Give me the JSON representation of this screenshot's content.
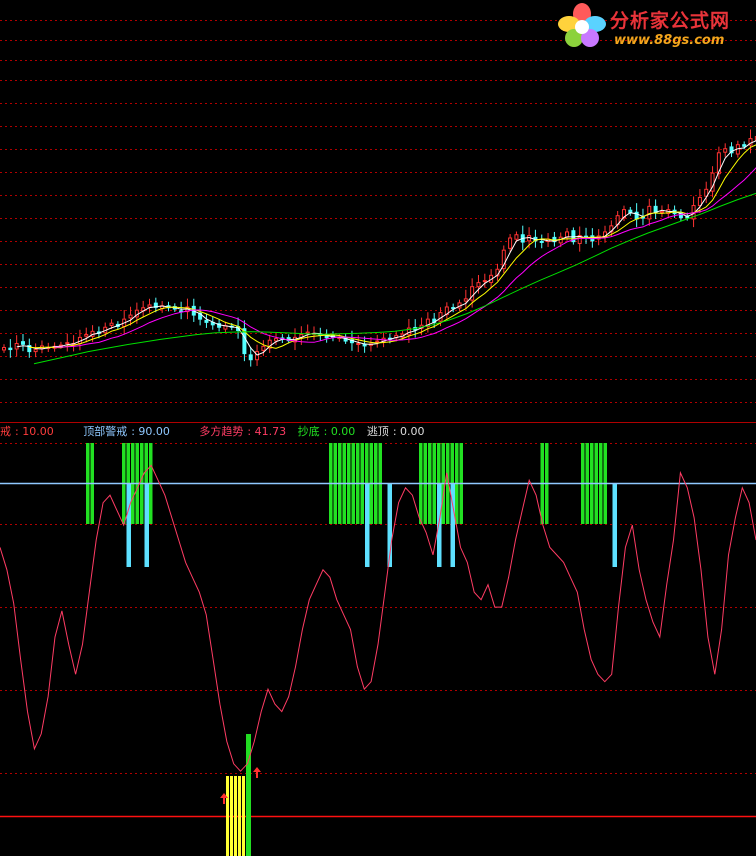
{
  "logo": {
    "brand": "分析家公式网",
    "url": "www.88gs.com"
  },
  "colors": {
    "background": "#000000",
    "grid": "#b00000",
    "bull_candle": "#ff3232",
    "bear_candle": "#54ffff",
    "ma_short": "#ffffff",
    "ma_mid": "#ffff00",
    "ma_long": "#ff00ff",
    "ma_trend": "#00e000",
    "osc_line": "#ff3c64",
    "top_level": "#8fc8ff",
    "bottom_level": "#ff1010",
    "top_zone_bar": "#22e022",
    "escape_bar": "#5ee0ff",
    "buy_bar": "#ffff33",
    "buy_strong_bar": "#22dd22",
    "arrow": "#ff3030"
  },
  "legend": [
    {
      "label": "戒",
      "value": "10.00",
      "color": "#ff3c3c"
    },
    {
      "label": "顶部警戒",
      "value": "90.00",
      "color": "#8fc8ff"
    },
    {
      "label": "多方趋势",
      "value": "41.73",
      "color": "#ff3c64"
    },
    {
      "label": "抄底",
      "value": "0.00",
      "color": "#22e022"
    },
    {
      "label": "逃顶",
      "value": "0.00",
      "color": "#dddddd"
    }
  ],
  "chart_data": [
    {
      "type": "candlestick",
      "title": "",
      "count": 120,
      "closes": [
        28,
        27.5,
        29,
        28.8,
        27,
        27.5,
        28.4,
        28,
        28.3,
        28.6,
        29.2,
        29,
        30.5,
        31.2,
        32,
        31.5,
        33,
        34,
        33.2,
        35,
        36,
        37.2,
        37.8,
        38.5,
        37.9,
        38.3,
        37.8,
        37.5,
        37,
        38,
        36,
        35,
        34.2,
        33.6,
        33,
        33.4,
        33,
        32.2,
        26.5,
        25,
        27,
        28.3,
        29.8,
        30.2,
        30,
        29.7,
        30.5,
        31.2,
        31.8,
        31.5,
        31,
        30.4,
        30.6,
        30.5,
        29.6,
        29.2,
        29,
        28.4,
        28.9,
        29.6,
        30.3,
        30.1,
        31,
        31.3,
        32.8,
        32.3,
        33.5,
        35,
        34.2,
        36.6,
        38,
        37.6,
        39,
        40,
        43,
        44,
        44.5,
        45.8,
        47.3,
        52,
        55,
        55.8,
        54,
        55.6,
        54.3,
        54,
        54.7,
        54.1,
        55.2,
        56.5,
        54.1,
        55.6,
        55.4,
        54.3,
        55.5,
        56.5,
        58,
        60.5,
        62,
        61.2,
        59.7,
        60,
        62.8,
        61.2,
        61.5,
        62,
        61,
        60,
        60,
        63,
        65,
        67,
        71,
        76,
        77,
        76,
        78,
        77.6,
        79.5,
        80
      ]
    },
    {
      "type": "line",
      "series": [
        {
          "name": "",
          "color": "#00e000",
          "values": [
            24,
            25,
            26,
            27,
            27.8,
            28.6,
            29.3,
            30,
            30.6,
            31.2,
            31.6,
            31.8,
            31.9,
            31.8,
            31.6,
            31.4,
            31.3,
            31.4,
            31.5,
            31.7,
            32,
            32.6,
            33.5,
            34.8,
            36.4,
            38.3,
            40.4,
            42.5,
            44.5,
            46.4,
            48.3,
            50.4,
            52.5,
            54.4,
            56.2,
            57.8,
            59.4,
            61,
            62.8,
            64.5,
            66
          ]
        }
      ]
    },
    {
      "type": "line",
      "title": "",
      "ylim": [
        0,
        100
      ],
      "reference_lines": [
        {
          "name": "顶部警戒",
          "value": 90
        },
        {
          "name": "",
          "value": 10
        }
      ],
      "series": [
        {
          "name": "多方趋势",
          "color": "#ff3c64",
          "values": [
            72,
            66,
            57,
            42,
            28,
            18,
            22,
            32,
            48,
            55,
            46,
            38,
            46,
            60,
            74,
            84,
            86,
            82,
            78,
            84,
            88,
            92,
            94,
            90,
            86,
            80,
            74,
            68,
            64,
            60,
            54,
            42,
            30,
            20,
            14,
            12,
            14,
            20,
            28,
            34,
            30,
            28,
            32,
            40,
            50,
            58,
            62,
            66,
            64,
            58,
            54,
            50,
            40,
            34,
            36,
            46,
            60,
            74,
            84,
            88,
            86,
            80,
            76,
            70,
            80,
            92,
            82,
            72,
            68,
            60,
            58,
            62,
            56,
            56,
            64,
            74,
            82,
            90,
            86,
            78,
            72,
            70,
            68,
            64,
            60,
            50,
            42,
            38,
            36,
            38,
            56,
            72,
            78,
            66,
            58,
            52,
            48,
            62,
            74,
            92,
            88,
            80,
            66,
            48,
            38,
            50,
            70,
            80,
            88,
            84,
            74
          ]
        }
      ],
      "top_zone_bars": [
        16,
        17,
        24,
        25,
        26,
        27,
        28,
        29,
        30,
        70,
        71,
        72,
        73,
        74,
        75,
        76,
        77,
        78,
        79,
        80,
        81,
        90,
        91,
        92,
        93,
        94,
        95,
        96,
        97,
        98,
        99,
        117,
        118,
        126,
        127,
        128,
        129,
        130,
        131
      ],
      "escape_bars": [
        25,
        29,
        78,
        83,
        94,
        97,
        133
      ],
      "buy_bars": [
        42,
        43,
        44,
        45,
        46
      ],
      "buy_strong_bars": [
        47
      ]
    }
  ]
}
